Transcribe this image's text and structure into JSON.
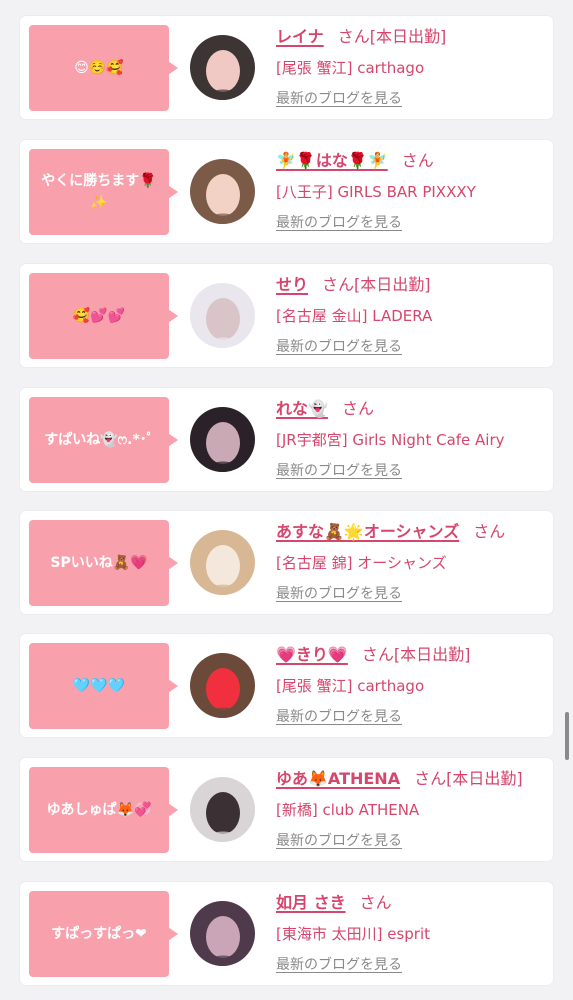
{
  "cards": [
    {
      "message": "😊☺️🥰",
      "name": "レイナ",
      "honorific": "さん",
      "status": "[本日出勤]",
      "shop": "[尾張 蟹江] carthago",
      "blog_link": "最新のブログを見る",
      "avatar_colors": [
        "#3d3533",
        "#f0c8c4"
      ]
    },
    {
      "message": "やくに勝ちます🌹✨",
      "name": "🧚🌹はな🌹🧚",
      "honorific": "さん",
      "status": "",
      "shop": "[八王子] GIRLS BAR PIXXXY",
      "blog_link": "最新のブログを見る",
      "avatar_colors": [
        "#7c5a48",
        "#f2d2c4"
      ]
    },
    {
      "message": "🥰💕💕",
      "name": "せり",
      "honorific": "さん",
      "status": "[本日出勤]",
      "shop": "[名古屋 金山] LADERA",
      "blog_link": "最新のブログを見る",
      "avatar_colors": [
        "#e9e6ee",
        "#d9c5c8"
      ]
    },
    {
      "message": "すぱいね👻ෆ.*･ﾟ",
      "name": "れな👻",
      "honorific": "さん",
      "status": "",
      "shop": "[JR宇都宮] Girls Night Cafe Airy",
      "blog_link": "最新のブログを見る",
      "avatar_colors": [
        "#2a2228",
        "#c9a9b4"
      ]
    },
    {
      "message": "SPいいね🧸💗",
      "name": "あすな🧸🌟オーシャンズ",
      "honorific": "さん",
      "status": "",
      "shop": "[名古屋 錦] オーシャンズ",
      "blog_link": "最新のブログを見る",
      "avatar_colors": [
        "#d8b794",
        "#f4e8dc"
      ]
    },
    {
      "message": "🩵🩵🩵",
      "name": "💗きり💗",
      "honorific": "さん",
      "status": "[本日出勤]",
      "shop": "[尾張 蟹江] carthago",
      "blog_link": "最新のブログを見る",
      "avatar_colors": [
        "#6b4a3a",
        "#f0303e"
      ]
    },
    {
      "message": "ゆあしゅぱ🦊💞",
      "name": "ゆあ🦊ATHENA",
      "honorific": "さん",
      "status": "[本日出勤]",
      "shop": "[新橋] club ATHENA",
      "blog_link": "最新のブログを見る",
      "avatar_colors": [
        "#d9d4d6",
        "#3b3034"
      ]
    },
    {
      "message": "すぱっすぱっ❤",
      "name": "如月 さき",
      "honorific": "さん",
      "status": "",
      "shop": "[東海市 太田川] esprit",
      "blog_link": "最新のブログを見る",
      "avatar_colors": [
        "#4e3a4a",
        "#caa5b8"
      ]
    }
  ]
}
